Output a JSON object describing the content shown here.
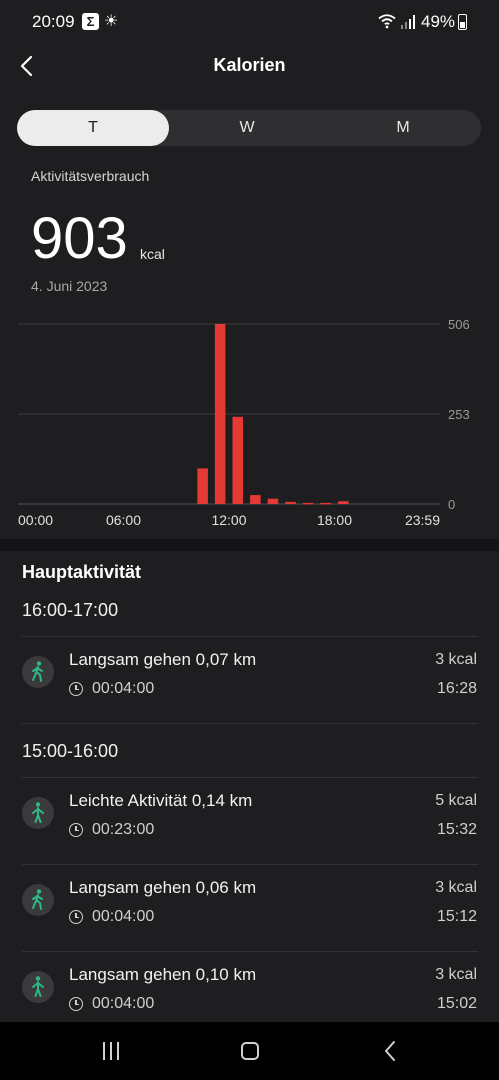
{
  "status_bar": {
    "time": "20:09",
    "battery": "49%"
  },
  "header": {
    "title": "Kalorien"
  },
  "tabs": [
    {
      "label": "T",
      "active": true
    },
    {
      "label": "W",
      "active": false
    },
    {
      "label": "M",
      "active": false
    }
  ],
  "summary": {
    "label": "Aktivitätsverbrauch",
    "value": "903",
    "unit": "kcal",
    "date": "4. Juni 2023"
  },
  "chart_data": {
    "type": "bar",
    "bar_color": "#e53935",
    "x_tick_labels": [
      "00:00",
      "06:00",
      "12:00",
      "18:00",
      "23:59"
    ],
    "y_tick_labels": [
      "506",
      "253",
      "0"
    ],
    "ylim": [
      0,
      506
    ],
    "grid": true,
    "bars": [
      {
        "hour": 10,
        "value": 100
      },
      {
        "hour": 11,
        "value": 506
      },
      {
        "hour": 12,
        "value": 245
      },
      {
        "hour": 13,
        "value": 25
      },
      {
        "hour": 14,
        "value": 15
      },
      {
        "hour": 15,
        "value": 6
      },
      {
        "hour": 16,
        "value": 3
      },
      {
        "hour": 17,
        "value": 3
      },
      {
        "hour": 18,
        "value": 8
      }
    ]
  },
  "main_activity": {
    "title": "Hauptaktivität",
    "groups": [
      {
        "range": "16:00-17:00",
        "items": [
          {
            "name": "Langsam gehen 0,07 km",
            "duration": "00:04:00",
            "kcal": "3 kcal",
            "time": "16:28",
            "icon": "walking-icon"
          }
        ]
      },
      {
        "range": "15:00-16:00",
        "items": [
          {
            "name": "Leichte Aktivität 0,14 km",
            "duration": "00:23:00",
            "kcal": "5 kcal",
            "time": "15:32",
            "icon": "standing-person-icon"
          },
          {
            "name": "Langsam gehen 0,06 km",
            "duration": "00:04:00",
            "kcal": "3 kcal",
            "time": "15:12",
            "icon": "walking-icon"
          },
          {
            "name": "Langsam gehen 0,10 km",
            "duration": "00:04:00",
            "kcal": "3 kcal",
            "time": "15:02",
            "icon": "standing-person-icon"
          }
        ]
      }
    ]
  },
  "colors": {
    "accent_green": "#2eb88a",
    "bar_red": "#e53935"
  }
}
